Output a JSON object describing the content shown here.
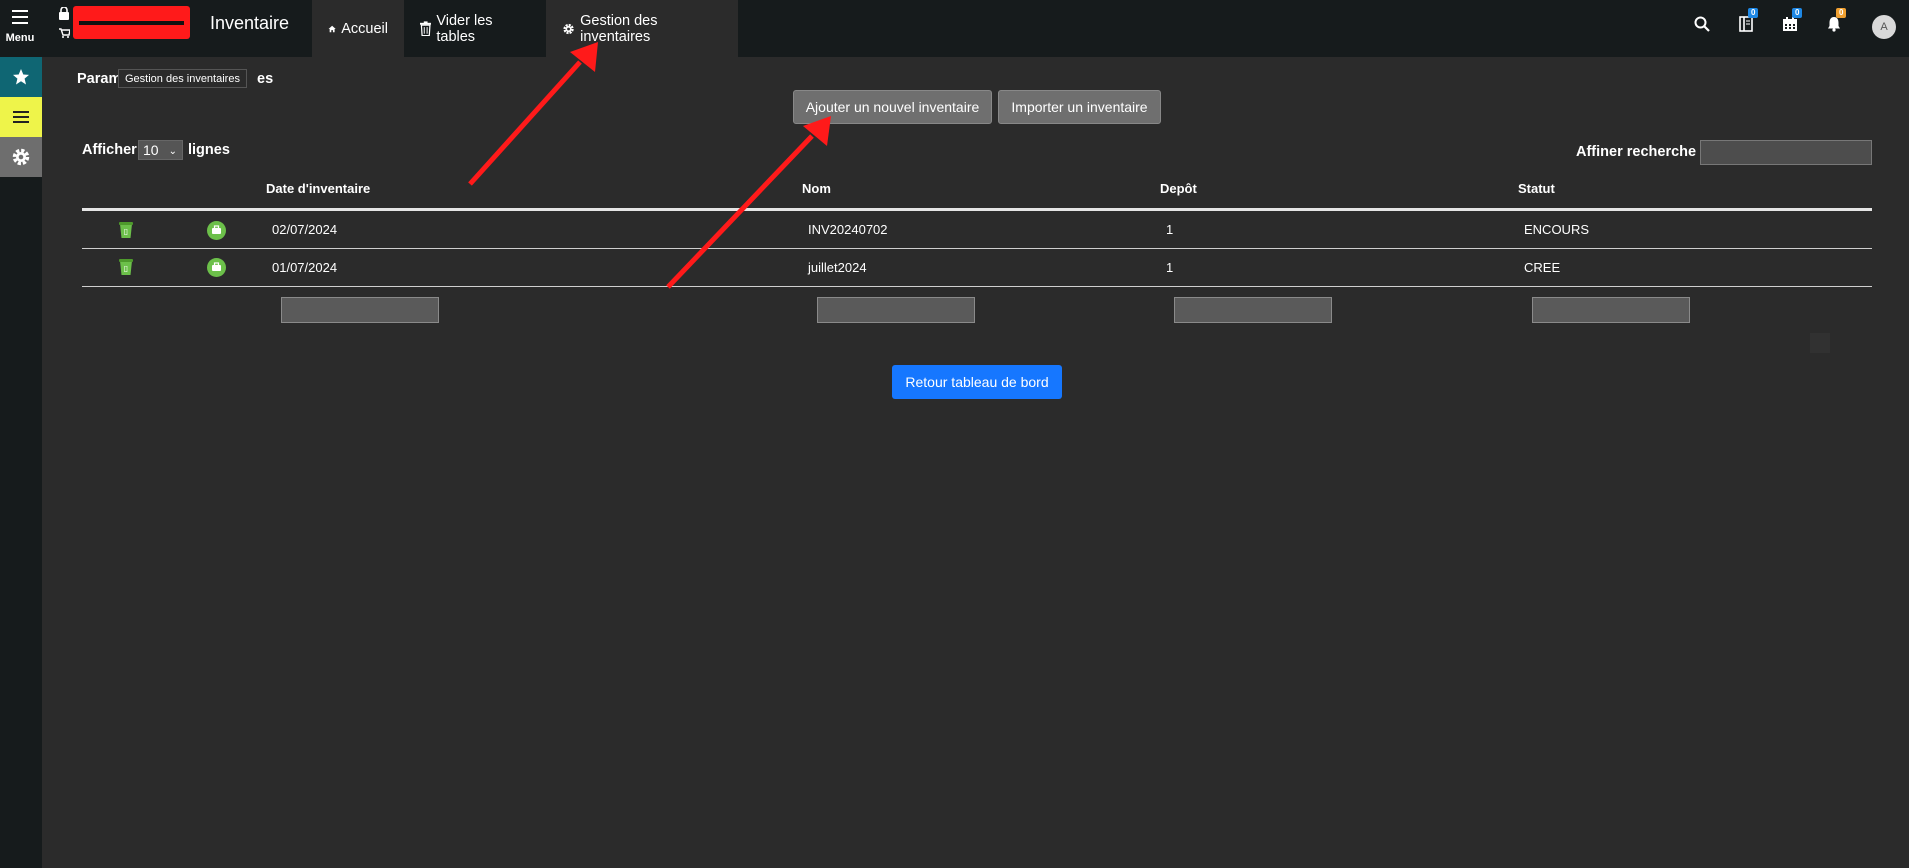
{
  "topbar": {
    "menu_label": "Menu",
    "app_title": "Inventaire",
    "tabs": [
      {
        "label": "Accueil",
        "icon": "home-icon"
      },
      {
        "label": "Vider les tables",
        "icon": "trash-icon"
      },
      {
        "label": "Gestion des inventaires",
        "icon": "gear-icon"
      }
    ],
    "badges": {
      "book": "0",
      "calendar": "0",
      "bell": "0"
    },
    "avatar_initial": "A"
  },
  "sidebar": {
    "items": [
      {
        "icon": "star-icon",
        "color": "#0f6673"
      },
      {
        "icon": "list-icon",
        "color": "#eef44a"
      },
      {
        "icon": "gear-icon",
        "color": "#6e6e6e"
      }
    ]
  },
  "page": {
    "breadcrumb_start": "Param",
    "breadcrumb_end": "es",
    "tooltip": "Gestion des inventaires",
    "add_button": "Ajouter un nouvel inventaire",
    "import_button": "Importer un inventaire",
    "show_prefix": "Afficher",
    "show_value": "10",
    "show_suffix": "lignes",
    "search_label": "Affiner recherche",
    "back_button": "Retour tableau de bord"
  },
  "table": {
    "headers": [
      "Date d'inventaire",
      "Nom",
      "Depôt",
      "Statut"
    ],
    "rows": [
      {
        "date": "02/07/2024",
        "name": "INV20240702",
        "depot": "1",
        "status": "ENCOURS"
      },
      {
        "date": "01/07/2024",
        "name": "juillet2024",
        "depot": "1",
        "status": "CREE"
      }
    ]
  },
  "colors": {
    "accent_blue": "#1677ff",
    "annotation_red": "#ff1a1a",
    "row_icon_green": "#6cc04a"
  }
}
